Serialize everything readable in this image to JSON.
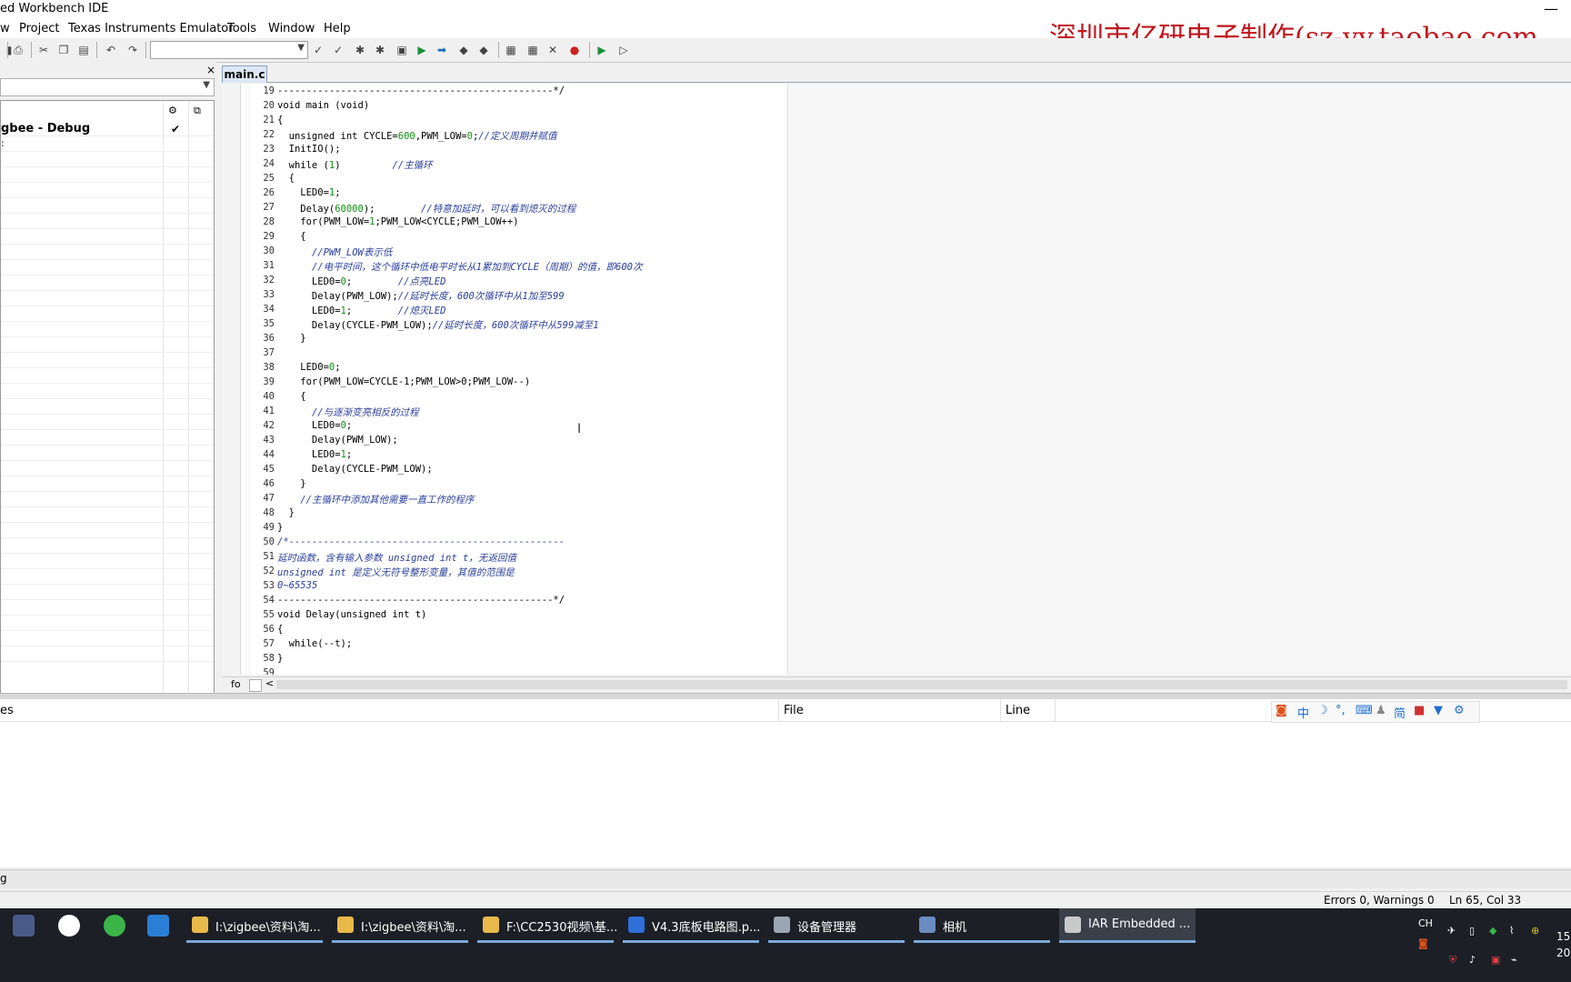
{
  "window": {
    "title": "ed Workbench IDE",
    "minimize_glyph": "—"
  },
  "menu": [
    "w",
    "Project",
    "Texas Instruments Emulator",
    "Tools",
    "Window",
    "Help"
  ],
  "watermark": "深圳市亿研电子制作(sz-yy.taobao.com",
  "workspace": {
    "close_glyph": "×",
    "project": "gbee - Debug",
    "check_glyph": "✔",
    "row_marker": ":"
  },
  "editor": {
    "tab": "main.c",
    "lines": [
      {
        "n": "19",
        "t": "------------------------------------------------*/"
      },
      {
        "n": "20",
        "t": "void main (void)"
      },
      {
        "n": "21",
        "t": "{"
      },
      {
        "n": "22",
        "t": "  unsigned int CYCLE=600,PWM_LOW=0;//定义周期并赋值"
      },
      {
        "n": "23",
        "t": "  InitIO();"
      },
      {
        "n": "24",
        "t": "  while (1)         //主循环"
      },
      {
        "n": "25",
        "t": "  {"
      },
      {
        "n": "26",
        "t": "    LED0=1;"
      },
      {
        "n": "27",
        "t": "    Delay(60000);        //特意加延时，可以看到熄灭的过程"
      },
      {
        "n": "28",
        "t": "    for(PWM_LOW=1;PWM_LOW<CYCLE;PWM_LOW++)"
      },
      {
        "n": "29",
        "t": "    {"
      },
      {
        "n": "30",
        "t": "      //PWM_LOW表示低"
      },
      {
        "n": "31",
        "t": "      //电平时间，这个循环中低电平时长从1累加到CYCLE（周期）的值，即600次"
      },
      {
        "n": "32",
        "t": "      LED0=0;        //点亮LED"
      },
      {
        "n": "33",
        "t": "      Delay(PWM_LOW);//延时长度，600次循环中从1加至599"
      },
      {
        "n": "34",
        "t": "      LED0=1;        //熄灭LED"
      },
      {
        "n": "35",
        "t": "      Delay(CYCLE-PWM_LOW);//延时长度，600次循环中从599减至1"
      },
      {
        "n": "36",
        "t": "    }"
      },
      {
        "n": "37",
        "t": ""
      },
      {
        "n": "38",
        "t": "    LED0=0;"
      },
      {
        "n": "39",
        "t": "    for(PWM_LOW=CYCLE-1;PWM_LOW>0;PWM_LOW--)"
      },
      {
        "n": "40",
        "t": "    {"
      },
      {
        "n": "41",
        "t": "      //与逐渐变亮相反的过程"
      },
      {
        "n": "42",
        "t": "      LED0=0;"
      },
      {
        "n": "43",
        "t": "      Delay(PWM_LOW);"
      },
      {
        "n": "44",
        "t": "      LED0=1;"
      },
      {
        "n": "45",
        "t": "      Delay(CYCLE-PWM_LOW);"
      },
      {
        "n": "46",
        "t": "    }"
      },
      {
        "n": "47",
        "t": "    //主循环中添加其他需要一直工作的程序"
      },
      {
        "n": "48",
        "t": "  }"
      },
      {
        "n": "49",
        "t": "}"
      },
      {
        "n": "50",
        "t": "/*------------------------------------------------"
      },
      {
        "n": "51",
        "t": "延时函数，含有输入参数 unsigned int t，无返回值"
      },
      {
        "n": "52",
        "t": "unsigned int 是定义无符号整形变量，其值的范围是"
      },
      {
        "n": "53",
        "t": "0~65535"
      },
      {
        "n": "54",
        "t": "------------------------------------------------*/"
      },
      {
        "n": "55",
        "t": "void Delay(unsigned int t)"
      },
      {
        "n": "56",
        "t": "{"
      },
      {
        "n": "57",
        "t": "  while(--t);"
      },
      {
        "n": "58",
        "t": "}"
      },
      {
        "n": "59",
        "t": ""
      }
    ],
    "hscroll_label": "fo",
    "hscroll_left": "<",
    "cursor_glyph": "I"
  },
  "messages": {
    "col_messages": "es",
    "col_file": "File",
    "col_line": "Line",
    "log_tab": "g"
  },
  "ime": [
    "中",
    "☽",
    "°,",
    "⌨",
    "简"
  ],
  "status": {
    "errors": "Errors 0, Warnings 0",
    "position": "Ln 65, Col 33"
  },
  "taskbar": {
    "items": [
      {
        "label": "I:\\zigbee\\资料\\淘...",
        "color": "#e8b84a"
      },
      {
        "label": "I:\\zigbee\\资料\\淘...",
        "color": "#e8b84a"
      },
      {
        "label": "F:\\CC2530视频\\基...",
        "color": "#e8b84a"
      },
      {
        "label": "V4.3底板电路图.p...",
        "color": "#2f6fd8"
      },
      {
        "label": "设备管理器",
        "color": "#9aa6b4"
      },
      {
        "label": "相机",
        "color": "#6a8cc0"
      },
      {
        "label": "IAR Embedded ...",
        "color": "#c9c9c9"
      }
    ],
    "tray_lang": "CH",
    "clock_time": "15",
    "clock_date": "20"
  },
  "colors": {
    "accent": "#2a3f9b",
    "watermark": "#c0151c",
    "taskbar": "#1c1f26"
  }
}
